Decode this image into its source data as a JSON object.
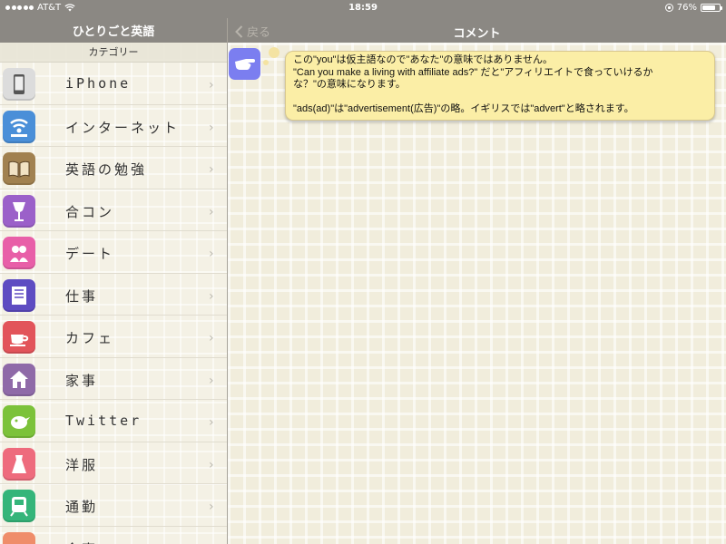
{
  "status_bar": {
    "carrier": "AT&T",
    "time": "18:59",
    "battery": "76%",
    "battery_level": 0.76
  },
  "left_nav": {
    "title": "ひとりごと英語"
  },
  "right_nav": {
    "title": "コメント",
    "back_label": "戻る"
  },
  "category_header": "カテゴリー",
  "categories": [
    {
      "label": "iPhone",
      "icon": "phone-icon",
      "color": "#dcdcdc"
    },
    {
      "label": "インターネット",
      "icon": "wifi-icon",
      "color": "#4a8fd8"
    },
    {
      "label": "英語の勉強",
      "icon": "book-icon",
      "color": "#a18150"
    },
    {
      "label": "合コン",
      "icon": "wine-glass-icon",
      "color": "#9b60c9"
    },
    {
      "label": "デート",
      "icon": "couple-icon",
      "color": "#e85fa8"
    },
    {
      "label": "仕事",
      "icon": "document-icon",
      "color": "#5e4cc2"
    },
    {
      "label": "カフェ",
      "icon": "cup-icon",
      "color": "#e2545a"
    },
    {
      "label": "家事",
      "icon": "house-icon",
      "color": "#8f6aa8"
    },
    {
      "label": "Twitter",
      "icon": "bird-icon",
      "color": "#7cc23a"
    },
    {
      "label": "洋服",
      "icon": "dress-icon",
      "color": "#ee6b7d"
    },
    {
      "label": "通勤",
      "icon": "train-icon",
      "color": "#35b57a"
    },
    {
      "label": "食事",
      "icon": "food-icon",
      "color": "#ef8d6a"
    }
  ],
  "comment": {
    "line1": "この\"you\"は仮主語なので\"あなた\"の意味ではありません。",
    "line2": "\"Can you make a living with affiliate ads?\" だと\"アフィリエイトで食っていけるか",
    "line3": "な？\"の意味になります。",
    "line4": "\"ads(ad)\"は\"advertisement(広告)\"の略。イギリスでは\"advert\"と略されます。"
  }
}
